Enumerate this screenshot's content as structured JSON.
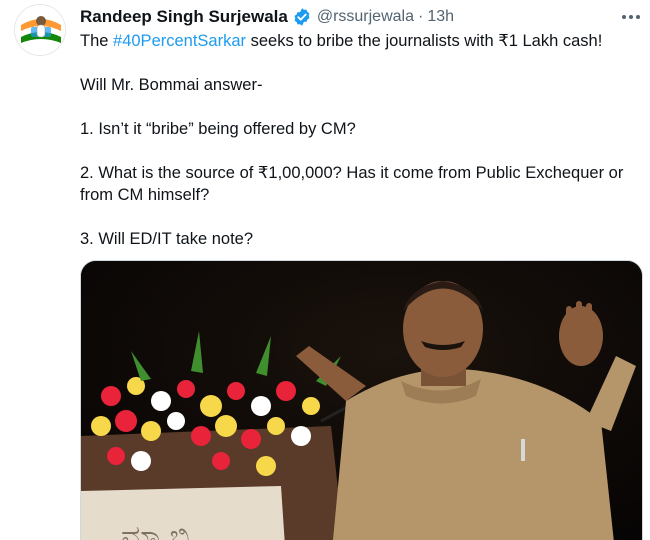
{
  "tweet": {
    "author": {
      "display_name": "Randeep Singh Surjewala",
      "handle": "@rssurjewala",
      "verified": true,
      "avatar_icon": "congress-party-avatar"
    },
    "separator": "·",
    "timestamp": "13h",
    "text": {
      "line1_prefix": "The ",
      "hashtag": "#40PercentSarkar",
      "line1_suffix": " seeks to bribe the journalists with ₹1 Lakh cash!",
      "line2": "Will Mr. Bommai answer-",
      "q1": "1. Isn’t it “bribe” being offered by CM?",
      "q2": "2. What is the source of ₹1,00,000? Has it come from Public Exchequer or from CM himself?",
      "q3": "3. Will ED/IT take note?"
    },
    "media": {
      "description_icon": "photo-man-speaking-at-podium"
    },
    "colors": {
      "link": "#1d9bf0",
      "verified": "#1d9bf0",
      "secondary_text": "#536471"
    }
  }
}
